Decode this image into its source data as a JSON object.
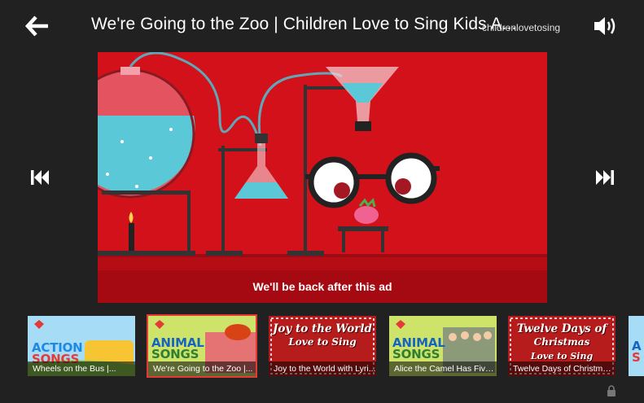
{
  "header": {
    "title": "We're Going to the Zoo | Children Love to Sing Kids A...",
    "channel": "childrenlovetosing"
  },
  "player": {
    "ad_text": "We'll be back after this ad"
  },
  "thumbnails": [
    {
      "label": "Wheels on the Bus |...",
      "art_word1": "ACTION",
      "art_word2": "SONGS",
      "selected": false
    },
    {
      "label": "We're Going to the Zoo |...",
      "art_word1": "ANIMAL",
      "art_word2": "SONGS",
      "selected": true
    },
    {
      "label": "Joy to the World with Lyri...",
      "art_line1": "Joy to the World",
      "art_line2": "Love to Sing",
      "selected": false
    },
    {
      "label": "Alice the Camel Has Five...",
      "art_word1": "ANIMAL",
      "art_word2": "SONGS",
      "selected": false
    },
    {
      "label": "Twelve Days of Christmas...",
      "art_line1": "Twelve Days of",
      "art_line2": "Christmas",
      "art_line3": "Love to Sing",
      "selected": false
    },
    {
      "label": "",
      "art_word1": "A",
      "art_word2": "S",
      "selected": false
    }
  ],
  "colors": {
    "background": "#212121",
    "video_red": "#d3111a",
    "selected_outline": "#e53935"
  },
  "icons": [
    "back-arrow-icon",
    "volume-icon",
    "skip-previous-icon",
    "skip-next-icon",
    "lock-icon"
  ]
}
